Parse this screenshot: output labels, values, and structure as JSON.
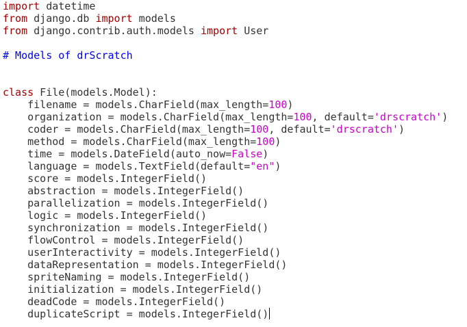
{
  "colors": {
    "text": "#333333",
    "keyword": "#a40000",
    "string": "#cc00cc",
    "number": "#cc00cc",
    "comment": "#0000ee",
    "background": "#ffffff"
  },
  "lines": [
    [
      {
        "t": "import",
        "k": "keyword"
      },
      {
        "t": " datetime",
        "k": "text"
      }
    ],
    [
      {
        "t": "from",
        "k": "keyword"
      },
      {
        "t": " django.db ",
        "k": "text"
      },
      {
        "t": "import",
        "k": "keyword"
      },
      {
        "t": " models",
        "k": "text"
      }
    ],
    [
      {
        "t": "from",
        "k": "keyword"
      },
      {
        "t": " django.contrib.auth.models ",
        "k": "text"
      },
      {
        "t": "import",
        "k": "keyword"
      },
      {
        "t": " User",
        "k": "text"
      }
    ],
    [],
    [
      {
        "t": "# Models of drScratch",
        "k": "comment"
      }
    ],
    [],
    [],
    [
      {
        "t": "class",
        "k": "keyword"
      },
      {
        "t": " File(models.Model):",
        "k": "text"
      }
    ],
    [
      {
        "t": "    filename = models.CharField(max_length=",
        "k": "text"
      },
      {
        "t": "100",
        "k": "number"
      },
      {
        "t": ")",
        "k": "text"
      }
    ],
    [
      {
        "t": "    organization = models.CharField(max_length=",
        "k": "text"
      },
      {
        "t": "100",
        "k": "number"
      },
      {
        "t": ", default=",
        "k": "text"
      },
      {
        "t": "'drscratch'",
        "k": "string"
      },
      {
        "t": ")",
        "k": "text"
      }
    ],
    [
      {
        "t": "    coder = models.CharField(max_length=",
        "k": "text"
      },
      {
        "t": "100",
        "k": "number"
      },
      {
        "t": ", default=",
        "k": "text"
      },
      {
        "t": "'drscratch'",
        "k": "string"
      },
      {
        "t": ")",
        "k": "text"
      }
    ],
    [
      {
        "t": "    method = models.CharField(max_length=",
        "k": "text"
      },
      {
        "t": "100",
        "k": "number"
      },
      {
        "t": ")",
        "k": "text"
      }
    ],
    [
      {
        "t": "    time = models.DateField(auto_now=",
        "k": "text"
      },
      {
        "t": "False",
        "k": "string"
      },
      {
        "t": ")",
        "k": "text"
      }
    ],
    [
      {
        "t": "    language = models.TextField(default=",
        "k": "text"
      },
      {
        "t": "\"en\"",
        "k": "string"
      },
      {
        "t": ")",
        "k": "text"
      }
    ],
    [
      {
        "t": "    score = models.IntegerField()",
        "k": "text"
      }
    ],
    [
      {
        "t": "    abstraction = models.IntegerField()",
        "k": "text"
      }
    ],
    [
      {
        "t": "    parallelization = models.IntegerField()",
        "k": "text"
      }
    ],
    [
      {
        "t": "    logic = models.IntegerField()",
        "k": "text"
      }
    ],
    [
      {
        "t": "    synchronization = models.IntegerField()",
        "k": "text"
      }
    ],
    [
      {
        "t": "    flowControl = models.IntegerField()",
        "k": "text"
      }
    ],
    [
      {
        "t": "    userInteractivity = models.IntegerField()",
        "k": "text"
      }
    ],
    [
      {
        "t": "    dataRepresentation = models.IntegerField()",
        "k": "text"
      }
    ],
    [
      {
        "t": "    spriteNaming = models.IntegerField()",
        "k": "text"
      }
    ],
    [
      {
        "t": "    initialization = models.IntegerField()",
        "k": "text"
      }
    ],
    [
      {
        "t": "    deadCode = models.IntegerField()",
        "k": "text"
      }
    ],
    [
      {
        "t": "    duplicateScript = models.IntegerField()",
        "k": "text"
      }
    ]
  ],
  "cursor": {
    "line": 25
  }
}
